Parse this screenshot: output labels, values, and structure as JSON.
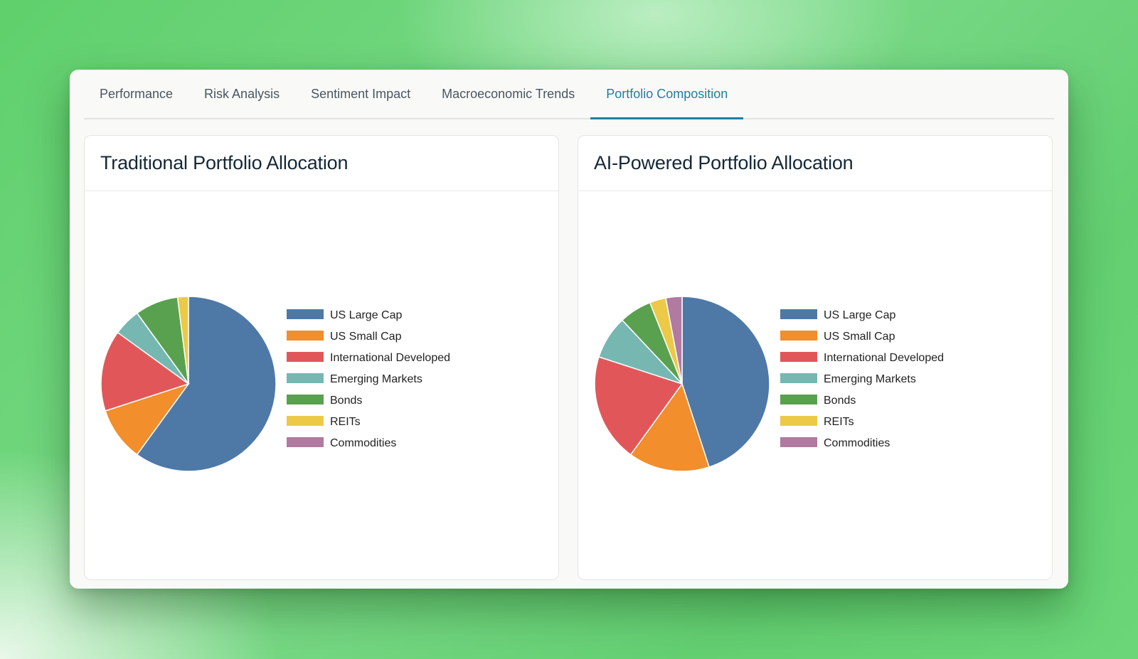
{
  "tabs": [
    {
      "label": "Performance",
      "active": false
    },
    {
      "label": "Risk Analysis",
      "active": false
    },
    {
      "label": "Sentiment Impact",
      "active": false
    },
    {
      "label": "Macroeconomic Trends",
      "active": false
    },
    {
      "label": "Portfolio Composition",
      "active": true
    }
  ],
  "colors": {
    "accent": "#1e7fa0",
    "series": [
      "#4e79a7",
      "#f28e2b",
      "#e15759",
      "#76b7b2",
      "#59a14f",
      "#edc948",
      "#b07aa1"
    ]
  },
  "cards": [
    {
      "title": "Traditional Portfolio Allocation"
    },
    {
      "title": "AI-Powered Portfolio Allocation"
    }
  ],
  "chart_data": [
    {
      "type": "pie",
      "title": "Traditional Portfolio Allocation",
      "categories": [
        "US Large Cap",
        "US Small Cap",
        "International Developed",
        "Emerging Markets",
        "Bonds",
        "REITs",
        "Commodities"
      ],
      "values": [
        60,
        10,
        15,
        5,
        8,
        2,
        0
      ],
      "legend": "right"
    },
    {
      "type": "pie",
      "title": "AI-Powered Portfolio Allocation",
      "categories": [
        "US Large Cap",
        "US Small Cap",
        "International Developed",
        "Emerging Markets",
        "Bonds",
        "REITs",
        "Commodities"
      ],
      "values": [
        45,
        15,
        20,
        8,
        6,
        3,
        3
      ],
      "legend": "right"
    }
  ]
}
